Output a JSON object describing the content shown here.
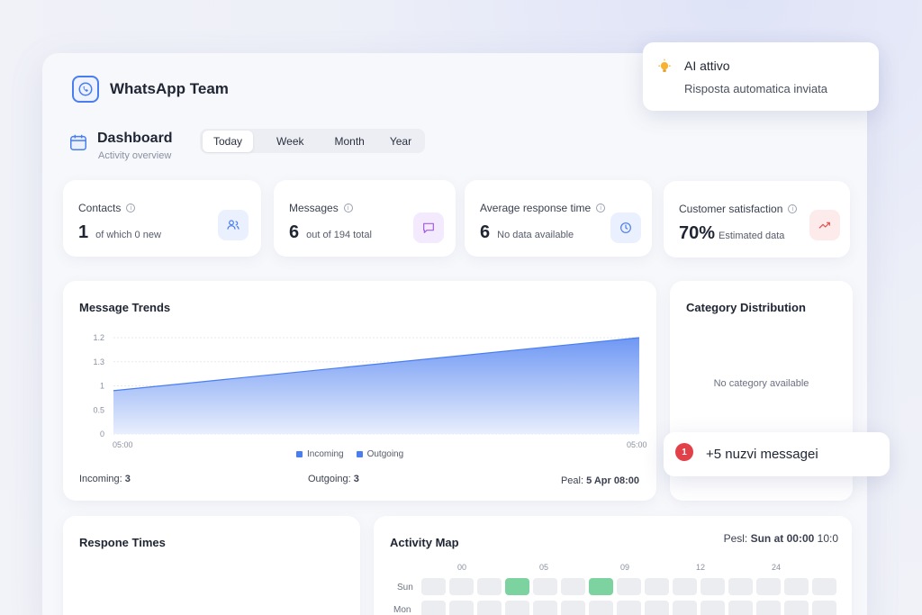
{
  "brand": {
    "name": "WhatsApp Team"
  },
  "notification_ai": {
    "title": "AI attivo",
    "subtitle": "Risposta automatica inviata"
  },
  "dashboard": {
    "title": "Dashboard",
    "subtitle": "Activity overview"
  },
  "tabs": [
    {
      "label": "Today",
      "active": true
    },
    {
      "label": "Week",
      "active": false
    },
    {
      "label": "Month",
      "active": false
    },
    {
      "label": "Year",
      "active": false
    }
  ],
  "stats": [
    {
      "label": "Contacts",
      "value": "1",
      "note": "of which 0 new",
      "icon": "users-icon",
      "color": "#4a7ef0",
      "bg": "#eaf0fd"
    },
    {
      "label": "Messages",
      "value": "6",
      "note": "out of 194 total",
      "icon": "message-icon",
      "color": "#a35ce6",
      "bg": "#f3eafd"
    },
    {
      "label": "Average response time",
      "value": "6",
      "note": "No data available",
      "icon": "clock-icon",
      "color": "#4a7ef0",
      "bg": "#eaf0fd"
    },
    {
      "label": "Customer satisfaction",
      "value": "70%",
      "note": "Estimated data",
      "icon": "trend-up-icon",
      "color": "#e2504f",
      "bg": "#fdebeb"
    }
  ],
  "trends": {
    "title": "Message Trends",
    "incoming_label": "Incoming:",
    "incoming_value": "3",
    "outgoing_label": "Outgoing:",
    "outgoing_value": "3",
    "peak_label": "Peal:",
    "peak_value": "5 Apr 08:00"
  },
  "chart_data": {
    "type": "area",
    "x": [
      "05:00",
      "05:00"
    ],
    "ytick_labels": [
      "0",
      "0.5",
      "1",
      "1.3",
      "1.2"
    ],
    "series": [
      {
        "name": "Incoming",
        "color": "#4a7ef0",
        "values": [
          0.9,
          2.0
        ]
      },
      {
        "name": "Outgoing",
        "color": "#4a7ef0",
        "values": []
      }
    ],
    "ylim": [
      0,
      2
    ],
    "grid": true,
    "legend": "bottom"
  },
  "category": {
    "title": "Category Distribution",
    "empty": "No category available"
  },
  "new_messages": {
    "badge": "1",
    "text": "+5 nuzvi messagei"
  },
  "response_times": {
    "title": "Respone Times"
  },
  "activity": {
    "title": "Activity Map",
    "peak_label": "Pesl:",
    "peak_value": "Sun at 00:00",
    "peak_extra": "10:0",
    "hour_labels": [
      "00",
      "05",
      "09",
      "12",
      "24"
    ],
    "days": [
      "Sun",
      "Mon"
    ],
    "active_cells": [
      [
        0,
        3
      ],
      [
        0,
        6
      ]
    ]
  }
}
